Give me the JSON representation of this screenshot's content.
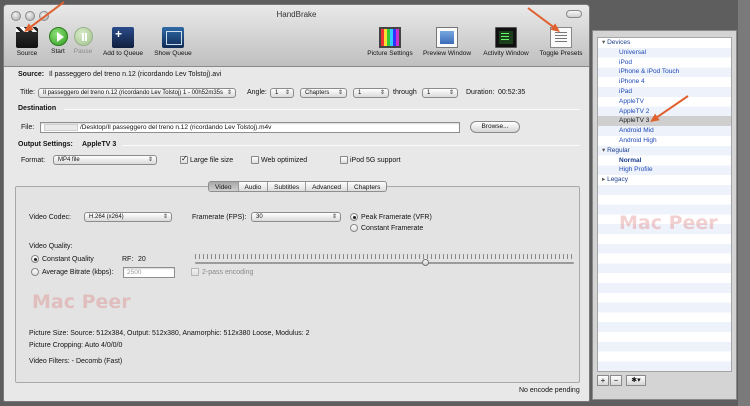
{
  "window": {
    "title": "HandBrake"
  },
  "toolbar": {
    "source": "Source",
    "start": "Start",
    "pause": "Pause",
    "add_to_queue": "Add to Queue",
    "show_queue": "Show Queue",
    "picture_settings": "Picture Settings",
    "preview_window": "Preview Window",
    "activity_window": "Activity Window",
    "toggle_presets": "Toggle Presets"
  },
  "source": {
    "label": "Source:",
    "value": "Il passeggero del treno n.12 (ricordando Lev Tolstoj).avi"
  },
  "title_row": {
    "title_label": "Title:",
    "title_value": "Il passeggero del treno n.12 (ricordando Lev Tolstoj) 1 - 00h52m35s",
    "angle_label": "Angle:",
    "angle_value": "1",
    "chapters_value": "Chapters",
    "from_value": "1",
    "through_label": "through",
    "to_value": "1",
    "duration_label": "Duration:",
    "duration_value": "00:52:35"
  },
  "destination": {
    "header": "Destination",
    "file_label": "File:",
    "file_value": "/Desktop/Il passeggero del treno n.12 (ricordando Lev Tolstoj).m4v",
    "browse": "Browse..."
  },
  "output": {
    "label": "Output Settings:",
    "preset": "AppleTV 3",
    "format_label": "Format:",
    "format_value": "MP4 file",
    "large_file": "Large file size",
    "web_optimized": "Web optimized",
    "ipod_5g": "iPod 5G support"
  },
  "tabs": [
    "Video",
    "Audio",
    "Subtitles",
    "Advanced",
    "Chapters"
  ],
  "video": {
    "codec_label": "Video Codec:",
    "codec_value": "H.264 (x264)",
    "framerate_label": "Framerate (FPS):",
    "framerate_value": "30",
    "peak_framerate": "Peak Framerate (VFR)",
    "constant_framerate": "Constant Framerate",
    "quality_label": "Video Quality:",
    "constant_quality": "Constant Quality",
    "rf_label": "RF:",
    "rf_value": "20",
    "avg_bitrate": "Average Bitrate (kbps):",
    "bitrate_value": "2500",
    "two_pass": "2-pass encoding",
    "quality_slider_fraction": 0.61
  },
  "picture_info": {
    "size": "Picture Size: Source: 512x384, Output: 512x380, Anamorphic: 512x380 Loose, Modulus: 2",
    "cropping": "Picture Cropping: Auto 4/0/0/0",
    "filters": "Video Filters:  - Decomb (Fast)"
  },
  "status": "No encode pending",
  "watermark": "Mac Peer",
  "presets": {
    "items": [
      {
        "label": "Devices",
        "kind": "group"
      },
      {
        "label": "Universal",
        "kind": "child"
      },
      {
        "label": "iPod",
        "kind": "child"
      },
      {
        "label": "iPhone & iPod Touch",
        "kind": "child"
      },
      {
        "label": "iPhone 4",
        "kind": "child"
      },
      {
        "label": "iPad",
        "kind": "child"
      },
      {
        "label": "AppleTV",
        "kind": "child"
      },
      {
        "label": "AppleTV 2",
        "kind": "child"
      },
      {
        "label": "AppleTV 3",
        "kind": "child-selected"
      },
      {
        "label": "Android Mid",
        "kind": "child"
      },
      {
        "label": "Android High",
        "kind": "child"
      },
      {
        "label": "Regular",
        "kind": "group"
      },
      {
        "label": "Normal",
        "kind": "child-default"
      },
      {
        "label": "High Profile",
        "kind": "child"
      },
      {
        "label": "Legacy",
        "kind": "group-collapsed"
      }
    ],
    "add": "+",
    "remove": "−",
    "gear": "✱▾"
  },
  "colors": {
    "annotation_arrow": "#e0602e",
    "preset_link": "#1f49b7"
  }
}
